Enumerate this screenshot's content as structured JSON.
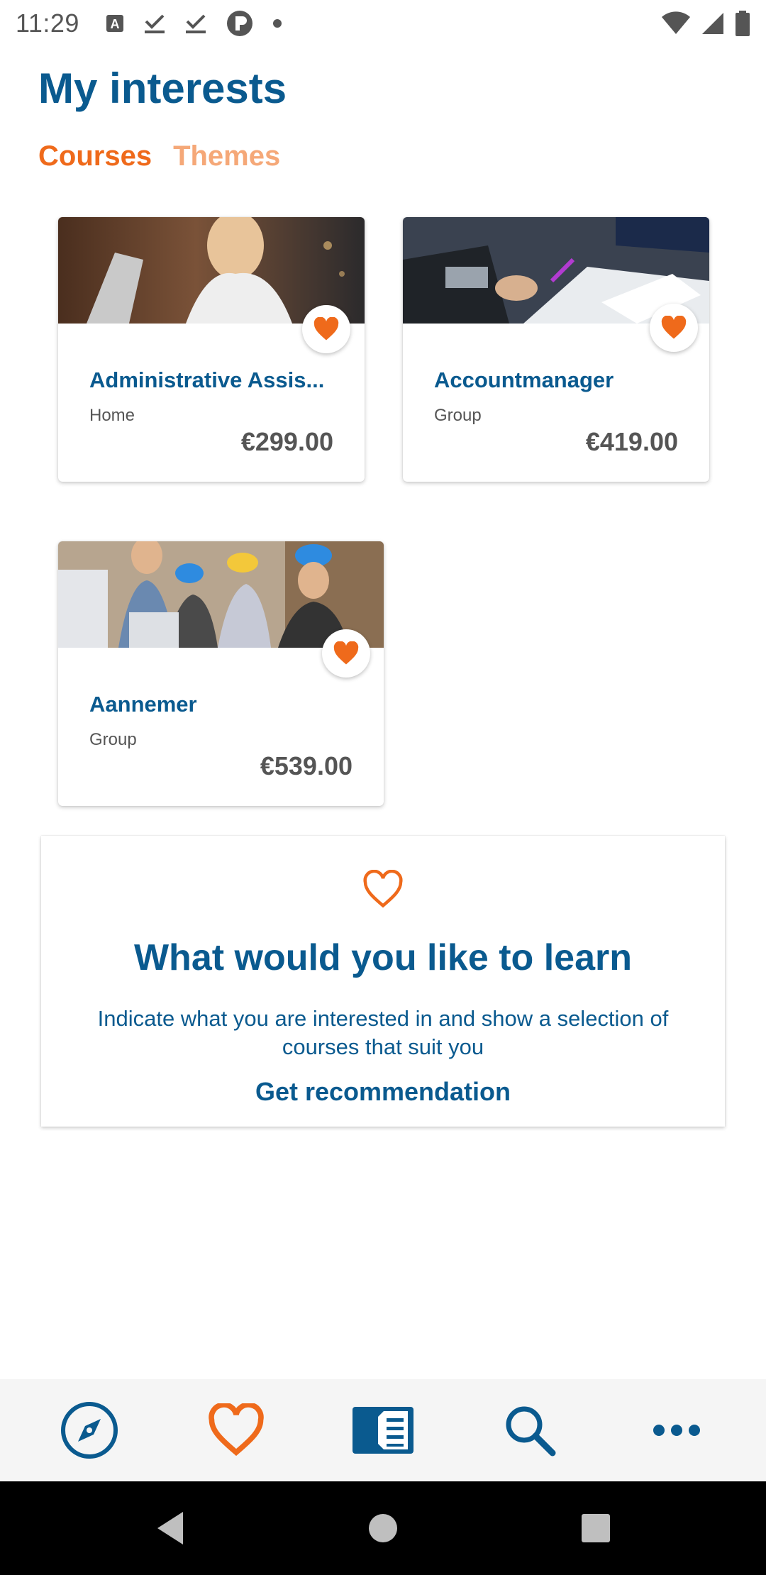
{
  "status_bar": {
    "time": "11:29",
    "left_icons": [
      "text-a-icon",
      "download-done-icon",
      "download-done-icon",
      "circle-p-icon",
      "dot-icon"
    ],
    "right_icons": [
      "wifi-icon",
      "signal-icon",
      "battery-icon"
    ]
  },
  "header": {
    "title": "My interests",
    "tabs": [
      {
        "label": "Courses",
        "active": true
      },
      {
        "label": "Themes",
        "active": false
      }
    ]
  },
  "courses": [
    {
      "title": "Administrative Assis...",
      "type": "Home",
      "price": "€299.00",
      "favorited": true
    },
    {
      "title": "Accountmanager",
      "type": "Group",
      "price": "€419.00",
      "favorited": true
    },
    {
      "title": "Aannemer",
      "type": "Group",
      "price": "€539.00",
      "favorited": true
    }
  ],
  "recommendation": {
    "title": "What would you like to learn",
    "description": "Indicate what you are interested in and show a selection of courses that suit you",
    "link_label": "Get recommendation"
  },
  "bottom_nav": {
    "items": [
      "compass-icon",
      "heart-icon",
      "catalog-icon",
      "search-icon",
      "more-icon"
    ],
    "active": "heart-icon"
  },
  "system_nav": [
    "back-icon",
    "home-icon",
    "recents-icon"
  ],
  "colors": {
    "primary_blue": "#0a5a8f",
    "accent_orange": "#ef6a1b",
    "inactive_orange": "#f5a878"
  }
}
